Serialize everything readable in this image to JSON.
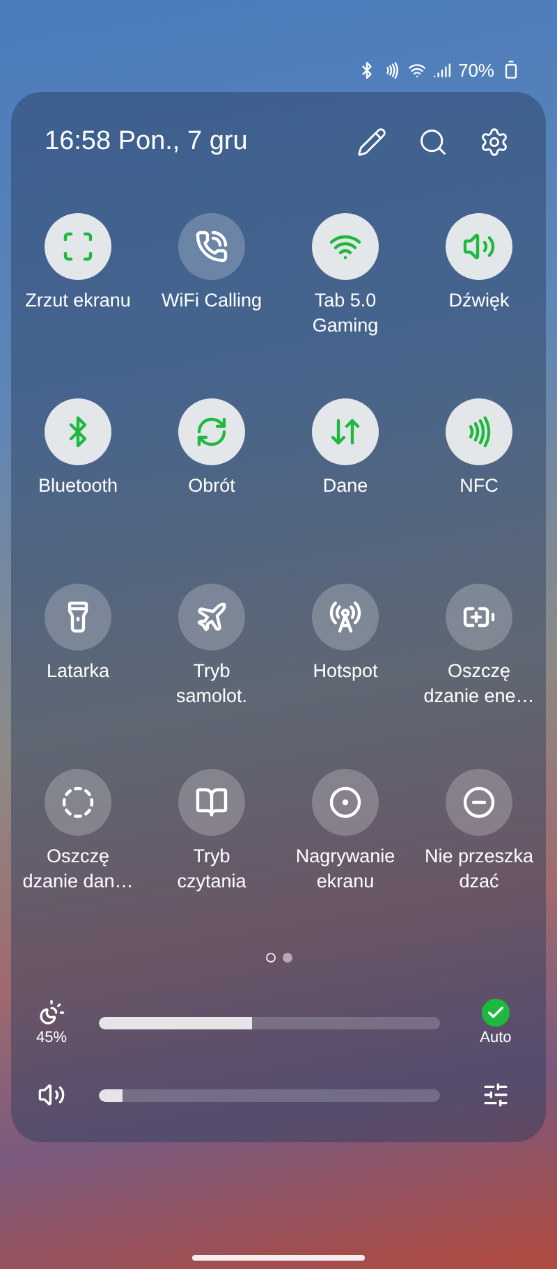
{
  "status_bar": {
    "icons": [
      {
        "kind": "bluetooth"
      },
      {
        "kind": "nfc"
      },
      {
        "kind": "wifi"
      },
      {
        "kind": "signal"
      }
    ],
    "battery": "70%"
  },
  "header": {
    "datetime": "16:58 Pon., 7 gru"
  },
  "tiles": [
    {
      "label": "Zrzut ekranu",
      "kind": "screenshot",
      "on": true
    },
    {
      "label": "WiFi Calling",
      "kind": "wificall",
      "on": false
    },
    {
      "label": "Tab 5.0\nGaming",
      "kind": "wifi",
      "on": true
    },
    {
      "label": "Dźwięk",
      "kind": "sound",
      "on": true
    },
    {
      "label": "Bluetooth",
      "kind": "bluetooth",
      "on": true
    },
    {
      "label": "Obrót",
      "kind": "rotate",
      "on": true
    },
    {
      "label": "Dane",
      "kind": "data",
      "on": true
    },
    {
      "label": "NFC",
      "kind": "nfc",
      "on": true
    },
    {
      "label": "Latarka",
      "kind": "flashlight",
      "on": false
    },
    {
      "label": "Tryb\nsamolot.",
      "kind": "plane",
      "on": false
    },
    {
      "label": "Hotspot",
      "kind": "hotspot",
      "on": false
    },
    {
      "label": "Oszczę\ndzanie ene…",
      "kind": "battery",
      "on": false
    },
    {
      "label": "Oszczę\ndzanie dan…",
      "kind": "datasaver",
      "on": false
    },
    {
      "label": "Tryb\nczytania",
      "kind": "book",
      "on": false
    },
    {
      "label": "Nagrywanie\nekranu",
      "kind": "record",
      "on": false
    },
    {
      "label": "Nie przeszka\ndzać",
      "kind": "dnd",
      "on": false
    }
  ],
  "pages": [
    {
      "selected": true
    },
    {
      "selected": false
    }
  ],
  "brightness": {
    "level": 0.45,
    "reading": "45%",
    "auto": {
      "label": "Auto",
      "checked": true
    }
  },
  "volume": {
    "level": 0.07
  }
}
